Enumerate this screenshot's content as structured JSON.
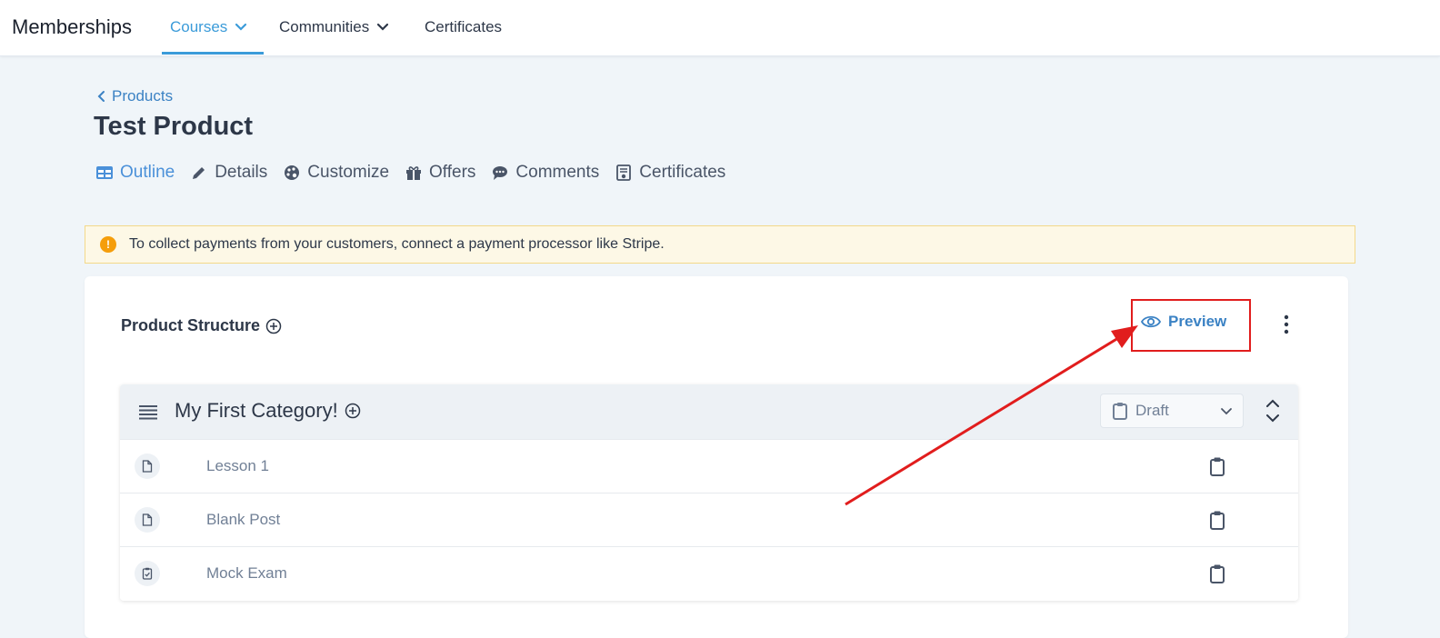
{
  "topbar": {
    "app_title": "Memberships",
    "nav": [
      {
        "label": "Courses",
        "active": true,
        "has_dropdown": true
      },
      {
        "label": "Communities",
        "active": false,
        "has_dropdown": true
      },
      {
        "label": "Certificates",
        "active": false,
        "has_dropdown": false
      }
    ]
  },
  "breadcrumb": {
    "label": "Products"
  },
  "page_title": "Test Product",
  "tabs": [
    {
      "label": "Outline",
      "icon": "table-icon",
      "active": true
    },
    {
      "label": "Details",
      "icon": "pencil-icon",
      "active": false
    },
    {
      "label": "Customize",
      "icon": "palette-icon",
      "active": false
    },
    {
      "label": "Offers",
      "icon": "gift-icon",
      "active": false
    },
    {
      "label": "Comments",
      "icon": "comment-icon",
      "active": false
    },
    {
      "label": "Certificates",
      "icon": "certificate-icon",
      "active": false
    }
  ],
  "alert": {
    "icon": "exclamation-icon",
    "text": "To collect payments from your customers, connect a payment processor like Stripe."
  },
  "structure": {
    "title": "Product Structure",
    "preview_label": "Preview",
    "category": {
      "title": "My First Category!",
      "status": "Draft",
      "lessons": [
        {
          "name": "Lesson 1",
          "type_icon": "file-icon"
        },
        {
          "name": "Blank Post",
          "type_icon": "file-icon"
        },
        {
          "name": "Mock Exam",
          "type_icon": "quiz-icon"
        }
      ]
    }
  },
  "colors": {
    "accent": "#3b9bd9",
    "link": "#3b82c4",
    "alert_bg": "#fdf8e6",
    "annotation": "#e11d1d"
  }
}
